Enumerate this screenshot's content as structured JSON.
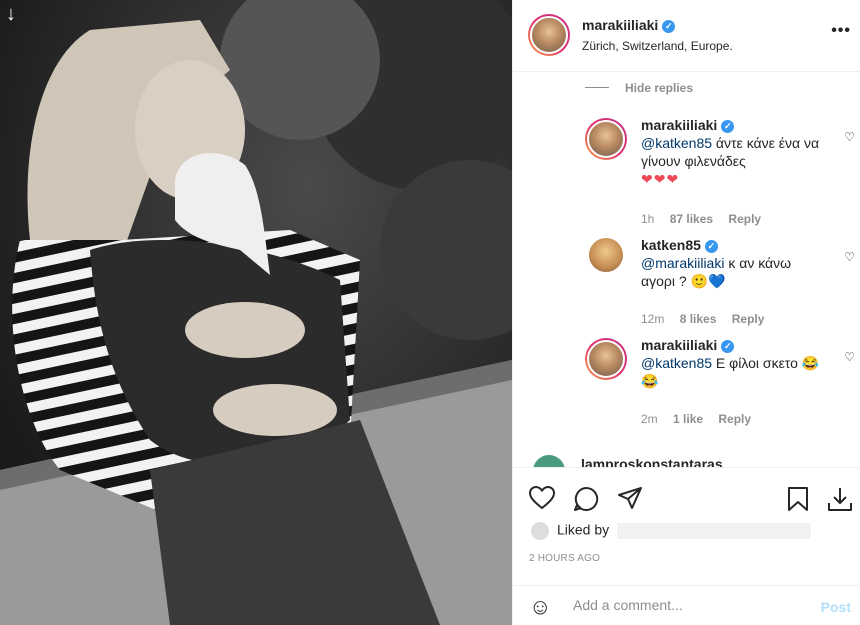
{
  "post": {
    "username": "marakiiliaki",
    "location": "Zürich, Switzerland, Europe.",
    "more_label": "•••",
    "download_glyph": "↓"
  },
  "comments": {
    "hide_replies": "Hide replies",
    "replies": [
      {
        "username": "marakiiliaki",
        "mention": "@katken85",
        "text": " άντε κάνε ένα να γίνουν φιλενάδες",
        "emoji": "❤❤❤",
        "time": "1h",
        "likes": "87 likes",
        "reply": "Reply",
        "avatar": "marakiiliaki-avatar"
      },
      {
        "username": "katken85",
        "mention": "@marakiiliaki",
        "text": " κ αν κάνω αγορι ?",
        "emoji": "🙂💙",
        "time": "12m",
        "likes": "8 likes",
        "reply": "Reply",
        "avatar": "katken85-avatar"
      },
      {
        "username": "marakiiliaki",
        "mention": "@katken85",
        "text": " Ε φίλοι σκετο",
        "emoji": "😂😂",
        "time": "2m",
        "likes": "1 like",
        "reply": "Reply",
        "avatar": "marakiiliaki-avatar"
      }
    ],
    "partial_comment": "lamproskonstantaras"
  },
  "actions": {
    "like_icon": "heart-icon",
    "comment_icon": "comment-icon",
    "share_icon": "share-icon",
    "save_icon": "bookmark-icon",
    "download_icon": "download-icon"
  },
  "likes_label": "Liked by",
  "time_ago": "2 HOURS AGO",
  "add_comment": {
    "placeholder": "Add a comment...",
    "post_label": "Post"
  },
  "colors": {
    "link": "#00376b",
    "verified": "#3897f0",
    "post_disabled": "#b2dffc"
  }
}
